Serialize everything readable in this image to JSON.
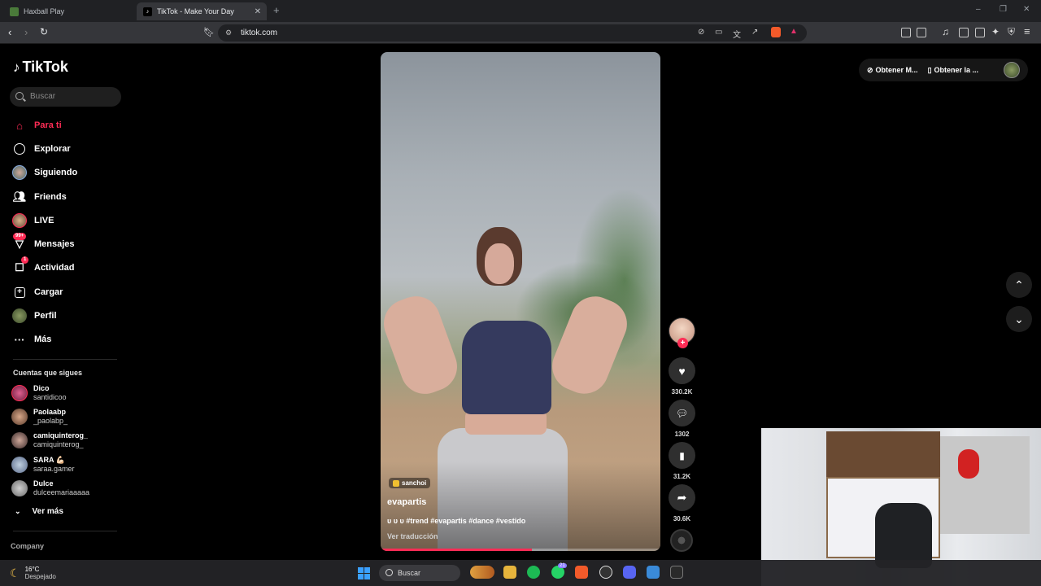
{
  "browser": {
    "tabs": [
      {
        "label": "Haxball Play",
        "active": false
      },
      {
        "label": "TikTok - Make Your Day",
        "active": true
      }
    ],
    "new_tab_label": "+",
    "url": "tiktok.com",
    "window_controls": [
      "–",
      "❐",
      "✕"
    ]
  },
  "sidebar": {
    "logo": "TikTok",
    "search_placeholder": "Buscar",
    "items": [
      {
        "label": "Para ti",
        "icon": "home-icon",
        "active": true
      },
      {
        "label": "Explorar",
        "icon": "compass-icon"
      },
      {
        "label": "Siguiendo",
        "icon": "following-avatar-icon"
      },
      {
        "label": "Friends",
        "icon": "friends-icon"
      },
      {
        "label": "LIVE",
        "icon": "live-icon"
      },
      {
        "label": "Mensajes",
        "icon": "messages-icon",
        "badge": "99+"
      },
      {
        "label": "Actividad",
        "icon": "activity-icon",
        "badge": "1"
      },
      {
        "label": "Cargar",
        "icon": "upload-icon"
      },
      {
        "label": "Perfil",
        "icon": "profile-avatar-icon"
      },
      {
        "label": "Más",
        "icon": "more-icon"
      }
    ],
    "following_title": "Cuentas que sigues",
    "accounts": [
      {
        "name": "Dico",
        "username": "santidicoo"
      },
      {
        "name": "Paolaabp",
        "username": "_paolabp_"
      },
      {
        "name": "camiquinterog_",
        "username": "camiquinterog_"
      },
      {
        "name": "SARA 💪🏻",
        "username": "saraa.gamer"
      },
      {
        "name": "Dulce",
        "username": "dulceemariaaaaa"
      }
    ],
    "see_more": "Ver más",
    "company": "Company"
  },
  "video": {
    "tag_chip": "sanchoi",
    "author": "evapartis",
    "description": "υ υ υ #trend #evapartis #dance #vestido",
    "translate": "Ver traducción",
    "progress_fraction": 0.54
  },
  "actions": {
    "likes": "330.2K",
    "comments": "1302",
    "saves": "31.2K",
    "shares": "30.6K"
  },
  "top_right": {
    "get_app_1": "Obtener M...",
    "get_app_2": "Obtener la ..."
  },
  "taskbar": {
    "temperature": "16°C",
    "weather": "Despejado",
    "search": "Buscar",
    "notif_badge": "21"
  },
  "colors": {
    "accent": "#fe2c55",
    "background": "#000000"
  }
}
